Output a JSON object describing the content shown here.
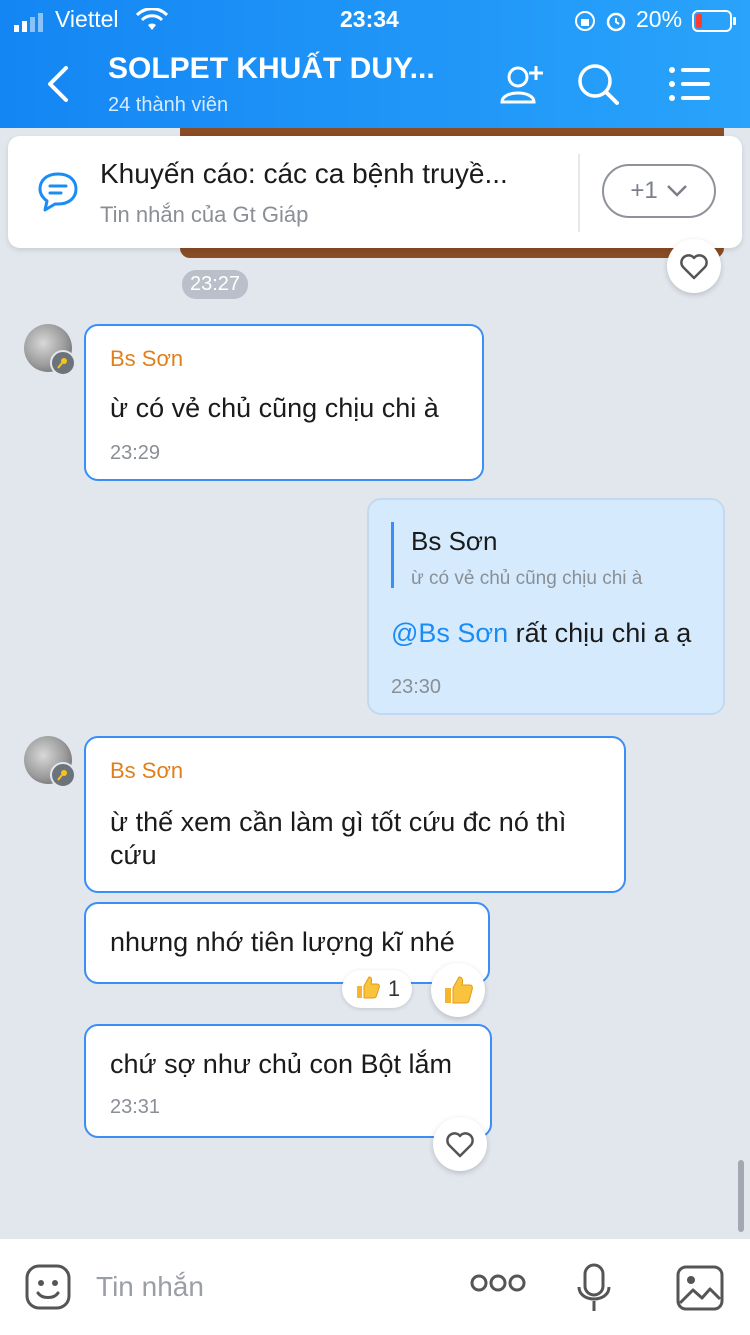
{
  "status_bar": {
    "carrier": "Viettel",
    "time": "23:34",
    "battery": "20%"
  },
  "header": {
    "title": "SOLPET KHUẤT DUY...",
    "subtitle": "24 thành viên",
    "icons": [
      "back-icon",
      "add-member-icon",
      "search-icon",
      "menu-icon"
    ]
  },
  "pinned": {
    "title": "Khuyến cáo: các ca bệnh truyề...",
    "subtitle": "Tin nhắn của Gt Giáp",
    "more": "+1"
  },
  "image_message": {
    "time": "23:27"
  },
  "messages": [
    {
      "sender": "Bs Sơn",
      "text": "ừ có vẻ chủ cũng chịu chi à",
      "time": "23:29"
    },
    {
      "quote_sender": "Bs Sơn",
      "quote_text": "ừ có vẻ chủ cũng chịu chi à",
      "mention": "@Bs Sơn",
      "text": " rất chịu chi a ạ",
      "time": "23:30"
    },
    {
      "sender": "Bs Sơn",
      "text": "ừ thế xem cần làm gì tốt cứu đc nó thì cứu"
    },
    {
      "text": "nhưng nhớ tiên lượng kĩ nhé",
      "reaction_count": "1"
    },
    {
      "text": "chứ sợ như chủ con Bột lắm",
      "time": "23:31"
    }
  ],
  "input": {
    "placeholder": "Tin nhắn"
  },
  "colors": {
    "header": "#1a8cf5",
    "accent": "#3a8ef6",
    "sender": "#e0801a",
    "mine_bubble": "#d5ebfd"
  }
}
